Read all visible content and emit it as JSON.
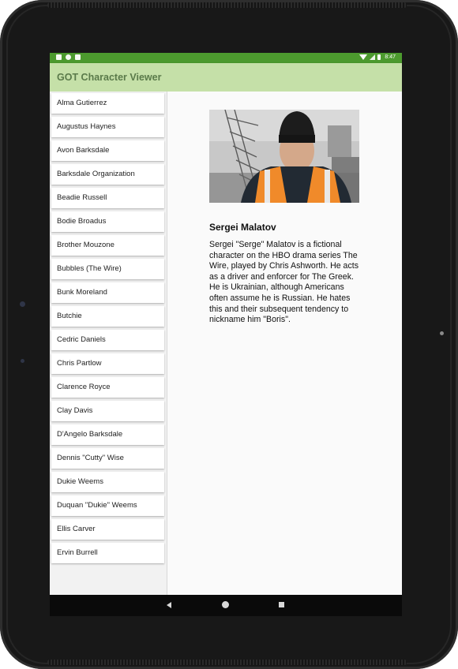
{
  "statusbar": {
    "time": "8:47"
  },
  "app": {
    "title": "GOT Character Viewer"
  },
  "characters": [
    "Alma Gutierrez",
    "Augustus Haynes",
    "Avon Barksdale",
    "Barksdale Organization",
    "Beadie Russell",
    "Bodie Broadus",
    "Brother Mouzone",
    "Bubbles (The Wire)",
    "Bunk Moreland",
    "Butchie",
    "Cedric Daniels",
    "Chris Partlow",
    "Clarence Royce",
    "Clay Davis",
    "D'Angelo Barksdale",
    "Dennis \"Cutty\" Wise",
    "Dukie Weems",
    "Duquan \"Dukie\" Weems",
    "Ellis Carver",
    "Ervin Burrell"
  ],
  "detail": {
    "name": "Sergei Malatov",
    "description": "Sergei \"Serge\" Malatov is a fictional character on the HBO drama series The Wire, played by Chris Ashworth. He acts as a driver and enforcer for The Greek. He is Ukrainian, although Americans often assume he is Russian. He hates this and their subsequent tendency to nickname him \"Boris\"."
  },
  "colors": {
    "statusbar": "#4c9a2e",
    "appbar": "#c5e0a8",
    "appbar_title": "#5a7a4a"
  },
  "icons": {
    "statusbar_left": [
      "notification-icon",
      "notification-icon",
      "sd-card-icon"
    ],
    "statusbar_right": [
      "wifi-icon",
      "signal-icon",
      "battery-icon"
    ],
    "nav": [
      "back-icon",
      "home-icon",
      "recents-icon"
    ]
  }
}
